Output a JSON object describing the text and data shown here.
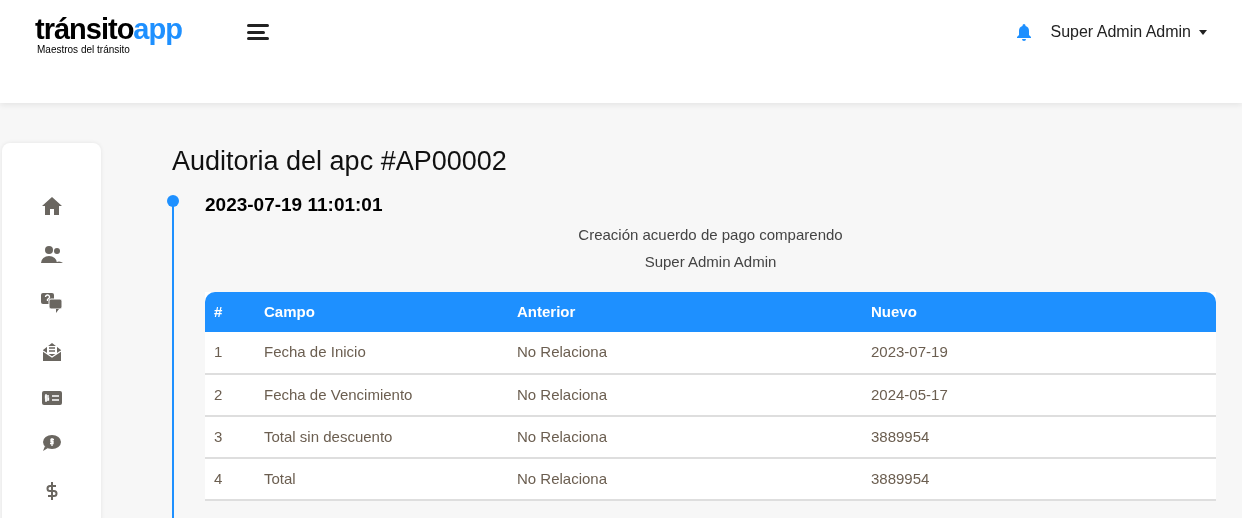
{
  "logo": {
    "name": "tránsito",
    "accent": "app",
    "tagline": "Maestros del tránsito"
  },
  "user": {
    "name": "Super Admin Admin"
  },
  "page_title": "Auditoria del apc #AP00002",
  "entries": [
    {
      "timestamp": "2023-07-19 11:01:01",
      "description": "Creación acuerdo de pago comparendo",
      "author": "Super Admin Admin",
      "table": {
        "columns": [
          "#",
          "Campo",
          "Anterior",
          "Nuevo"
        ],
        "rows": [
          [
            "1",
            "Fecha de Inicio",
            "No Relaciona",
            "2023-07-19"
          ],
          [
            "2",
            "Fecha de Vencimiento",
            "No Relaciona",
            "2024-05-17"
          ],
          [
            "3",
            "Total sin descuento",
            "No Relaciona",
            "3889954"
          ],
          [
            "4",
            "Total",
            "No Relaciona",
            "3889954"
          ]
        ]
      }
    }
  ]
}
